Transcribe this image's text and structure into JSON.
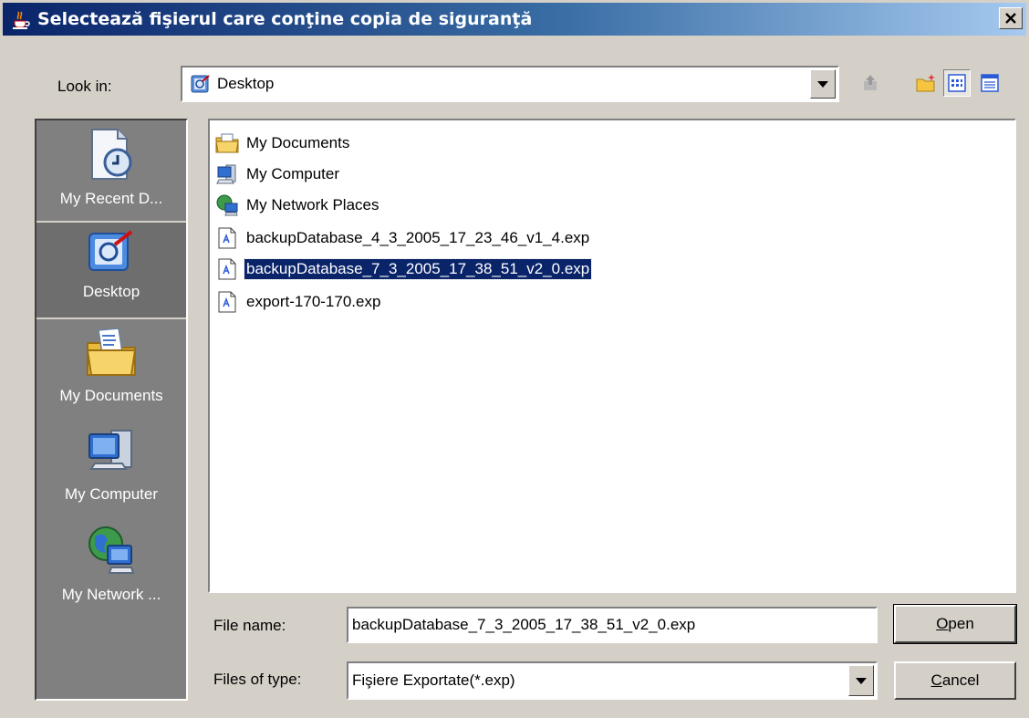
{
  "window": {
    "title": "Selectează fişierul care conţine copia de siguranţă",
    "close_label": "x"
  },
  "toolbar": {
    "look_in_label": "Look in:",
    "look_in_value": "Desktop",
    "tools": [
      "up-folder-icon",
      "new-folder-icon",
      "list-view-icon",
      "details-view-icon"
    ]
  },
  "sidebar": {
    "items": [
      {
        "label": "My Recent D...",
        "icon": "recent-documents-icon"
      },
      {
        "label": "Desktop",
        "icon": "desktop-icon",
        "selected": true
      },
      {
        "label": "My Documents",
        "icon": "my-documents-icon"
      },
      {
        "label": "My Computer",
        "icon": "my-computer-icon"
      },
      {
        "label": "My Network ...",
        "icon": "network-places-icon"
      }
    ]
  },
  "files": [
    {
      "name": "My Documents",
      "icon": "folder-icon"
    },
    {
      "name": "My Computer",
      "icon": "computer-icon"
    },
    {
      "name": "My Network Places",
      "icon": "network-icon"
    },
    {
      "name": "backupDatabase_4_3_2005_17_23_46_v1_4.exp",
      "icon": "file-icon"
    },
    {
      "name": "backupDatabase_7_3_2005_17_38_51_v2_0.exp",
      "icon": "file-icon",
      "selected": true
    },
    {
      "name": "export-170-170.exp",
      "icon": "file-icon"
    }
  ],
  "form": {
    "file_name_label": "File name:",
    "file_name_value": "backupDatabase_7_3_2005_17_38_51_v2_0.exp",
    "file_type_label": "Files of type:",
    "file_type_value": "Fişiere Exportate(*.exp)"
  },
  "buttons": {
    "open_mnemonic": "O",
    "open_rest": "pen",
    "cancel_mnemonic": "C",
    "cancel_rest": "ancel"
  }
}
